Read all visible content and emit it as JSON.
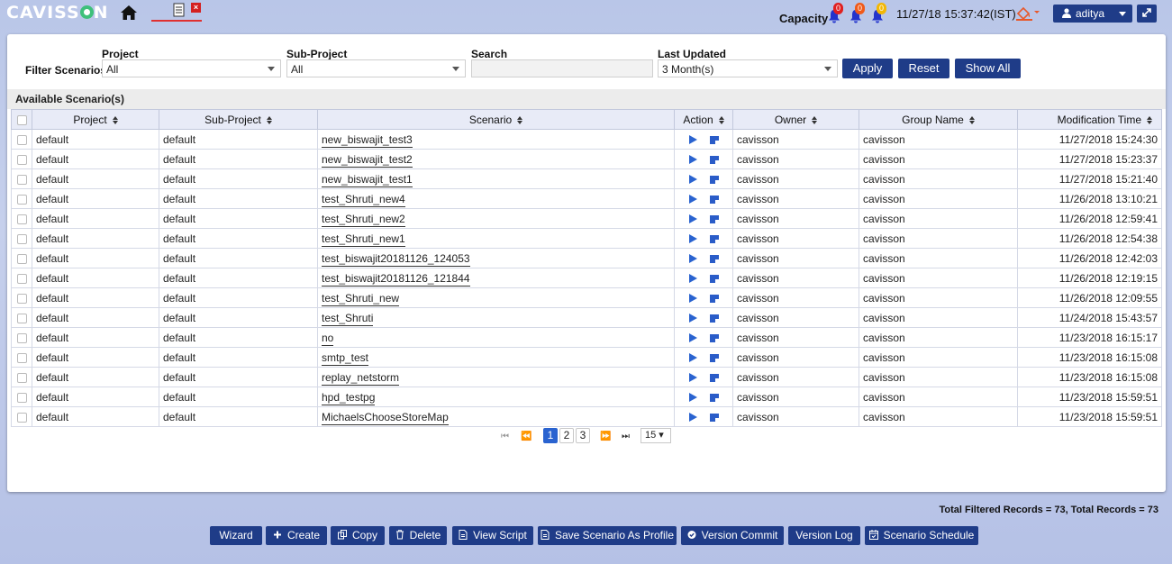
{
  "header": {
    "logo_text": "CAVISS",
    "logo_text_end": "N",
    "capacity_label": "Capacity",
    "alerts": [
      {
        "name": "critical",
        "count": "0",
        "color": "#e02020"
      },
      {
        "name": "major",
        "count": "0",
        "color": "#f05a1a"
      },
      {
        "name": "minor",
        "count": "0",
        "color": "#f2b705"
      }
    ],
    "datetime": "11/27/18 15:37:42(IST)",
    "username": "aditya"
  },
  "filters": {
    "label": "Filter Scenarios:",
    "project_label": "Project",
    "project_value": "All",
    "subproject_label": "Sub-Project",
    "subproject_value": "All",
    "search_label": "Search",
    "search_value": "",
    "updated_label": "Last Updated",
    "updated_value": "3 Month(s)",
    "apply_label": "Apply",
    "reset_label": "Reset",
    "showall_label": "Show All"
  },
  "table": {
    "title": "Available Scenario(s)",
    "columns": [
      "Project",
      "Sub-Project",
      "Scenario",
      "Action",
      "Owner",
      "Group Name",
      "Modification Time"
    ],
    "rows": [
      {
        "project": "default",
        "subproject": "default",
        "scenario": "new_biswajit_test3",
        "owner": "cavisson",
        "group": "cavisson",
        "time": "11/27/2018 15:24:30"
      },
      {
        "project": "default",
        "subproject": "default",
        "scenario": "new_biswajit_test2",
        "owner": "cavisson",
        "group": "cavisson",
        "time": "11/27/2018 15:23:37"
      },
      {
        "project": "default",
        "subproject": "default",
        "scenario": "new_biswajit_test1",
        "owner": "cavisson",
        "group": "cavisson",
        "time": "11/27/2018 15:21:40"
      },
      {
        "project": "default",
        "subproject": "default",
        "scenario": "test_Shruti_new4",
        "owner": "cavisson",
        "group": "cavisson",
        "time": "11/26/2018 13:10:21"
      },
      {
        "project": "default",
        "subproject": "default",
        "scenario": "test_Shruti_new2",
        "owner": "cavisson",
        "group": "cavisson",
        "time": "11/26/2018 12:59:41"
      },
      {
        "project": "default",
        "subproject": "default",
        "scenario": "test_Shruti_new1",
        "owner": "cavisson",
        "group": "cavisson",
        "time": "11/26/2018 12:54:38"
      },
      {
        "project": "default",
        "subproject": "default",
        "scenario": "test_biswajit20181126_124053",
        "owner": "cavisson",
        "group": "cavisson",
        "time": "11/26/2018 12:42:03"
      },
      {
        "project": "default",
        "subproject": "default",
        "scenario": "test_biswajit20181126_121844",
        "owner": "cavisson",
        "group": "cavisson",
        "time": "11/26/2018 12:19:15"
      },
      {
        "project": "default",
        "subproject": "default",
        "scenario": "test_Shruti_new",
        "owner": "cavisson",
        "group": "cavisson",
        "time": "11/26/2018 12:09:55"
      },
      {
        "project": "default",
        "subproject": "default",
        "scenario": "test_Shruti",
        "owner": "cavisson",
        "group": "cavisson",
        "time": "11/24/2018 15:43:57"
      },
      {
        "project": "default",
        "subproject": "default",
        "scenario": "no",
        "owner": "cavisson",
        "group": "cavisson",
        "time": "11/23/2018 16:15:17"
      },
      {
        "project": "default",
        "subproject": "default",
        "scenario": "smtp_test",
        "owner": "cavisson",
        "group": "cavisson",
        "time": "11/23/2018 16:15:08"
      },
      {
        "project": "default",
        "subproject": "default",
        "scenario": "replay_netstorm",
        "owner": "cavisson",
        "group": "cavisson",
        "time": "11/23/2018 16:15:08"
      },
      {
        "project": "default",
        "subproject": "default",
        "scenario": "hpd_testpg",
        "owner": "cavisson",
        "group": "cavisson",
        "time": "11/23/2018 15:59:51"
      },
      {
        "project": "default",
        "subproject": "default",
        "scenario": "MichaelsChooseStoreMap",
        "owner": "cavisson",
        "group": "cavisson",
        "time": "11/23/2018 15:59:51"
      }
    ]
  },
  "pager": {
    "pages": [
      "1",
      "2",
      "3"
    ],
    "current": "1",
    "page_size": "15"
  },
  "totals": "Total Filtered Records = 73, Total Records = 73",
  "actions": [
    {
      "label": "Wizard",
      "icon": ""
    },
    {
      "label": "Create",
      "icon": "plus-icon"
    },
    {
      "label": "Copy",
      "icon": "copy-icon"
    },
    {
      "label": "Delete",
      "icon": "trash-icon"
    },
    {
      "label": "View Script",
      "icon": "file-icon"
    },
    {
      "label": "Save Scenario As Profile",
      "icon": "file-icon"
    },
    {
      "label": "Version Commit",
      "icon": "check-circle-icon"
    },
    {
      "label": "Version Log",
      "icon": ""
    },
    {
      "label": "Scenario Schedule",
      "icon": "calendar-icon"
    }
  ]
}
